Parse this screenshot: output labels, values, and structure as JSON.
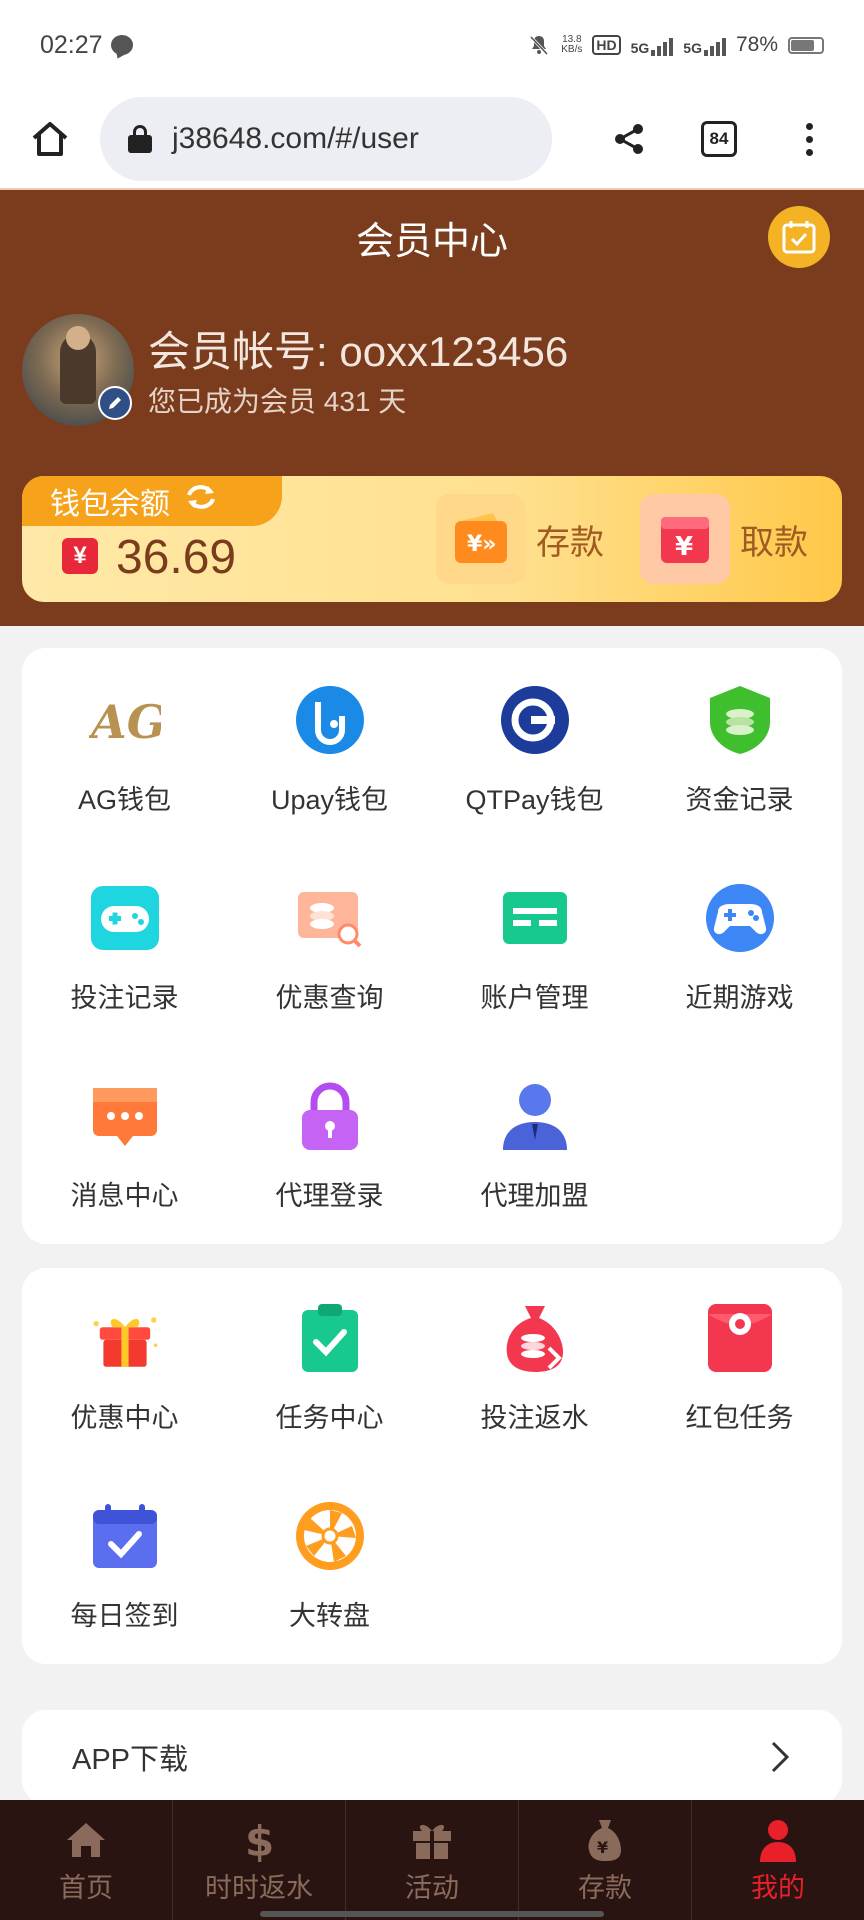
{
  "status_bar": {
    "time": "02:27",
    "net_speed_value": "13.8",
    "net_speed_unit": "KB/s",
    "hd_label": "HD",
    "sim1_label": "5G",
    "sim2_label": "5G",
    "battery": "78%",
    "battery_level": 0.78
  },
  "browser": {
    "url": "j38648.com/#/user",
    "tab_count": "84"
  },
  "header": {
    "title": "会员中心",
    "account_label": "会员帐号: ooxx123456",
    "member_days": "您已成为会员 431 天"
  },
  "wallet": {
    "label": "钱包余额",
    "currency_symbol": "¥",
    "balance": "36.69",
    "deposit_label": "存款",
    "withdraw_label": "取款"
  },
  "grid1": [
    {
      "label": "AG钱包",
      "icon": "ag-logo-icon"
    },
    {
      "label": "Upay钱包",
      "icon": "upay-icon"
    },
    {
      "label": "QTPay钱包",
      "icon": "qtpay-icon"
    },
    {
      "label": "资金记录",
      "icon": "funds-record-icon"
    },
    {
      "label": "投注记录",
      "icon": "gamepad-icon"
    },
    {
      "label": "优惠查询",
      "icon": "coupon-search-icon"
    },
    {
      "label": "账户管理",
      "icon": "card-icon"
    },
    {
      "label": "近期游戏",
      "icon": "controller-icon"
    },
    {
      "label": "消息中心",
      "icon": "message-icon"
    },
    {
      "label": "代理登录",
      "icon": "lock-icon"
    },
    {
      "label": "代理加盟",
      "icon": "agent-icon"
    }
  ],
  "grid2": [
    {
      "label": "优惠中心",
      "icon": "gift-icon"
    },
    {
      "label": "任务中心",
      "icon": "clipboard-check-icon"
    },
    {
      "label": "投注返水",
      "icon": "money-bag-icon"
    },
    {
      "label": "红包任务",
      "icon": "red-envelope-icon"
    },
    {
      "label": "每日签到",
      "icon": "calendar-check-icon"
    },
    {
      "label": "大转盘",
      "icon": "wheel-icon"
    }
  ],
  "app_download": {
    "label": "APP下载"
  },
  "bottom_nav": [
    {
      "label": "首页",
      "icon": "home-icon"
    },
    {
      "label": "时时返水",
      "icon": "dollar-icon"
    },
    {
      "label": "活动",
      "icon": "gift-icon"
    },
    {
      "label": "存款",
      "icon": "money-bag-icon"
    },
    {
      "label": "我的",
      "icon": "user-icon",
      "active": true
    }
  ],
  "colors": {
    "header_bg": "#7a3c1c",
    "accent_orange": "#f7a21b",
    "active_red": "#e8202a",
    "nav_bg": "#2a1411"
  }
}
